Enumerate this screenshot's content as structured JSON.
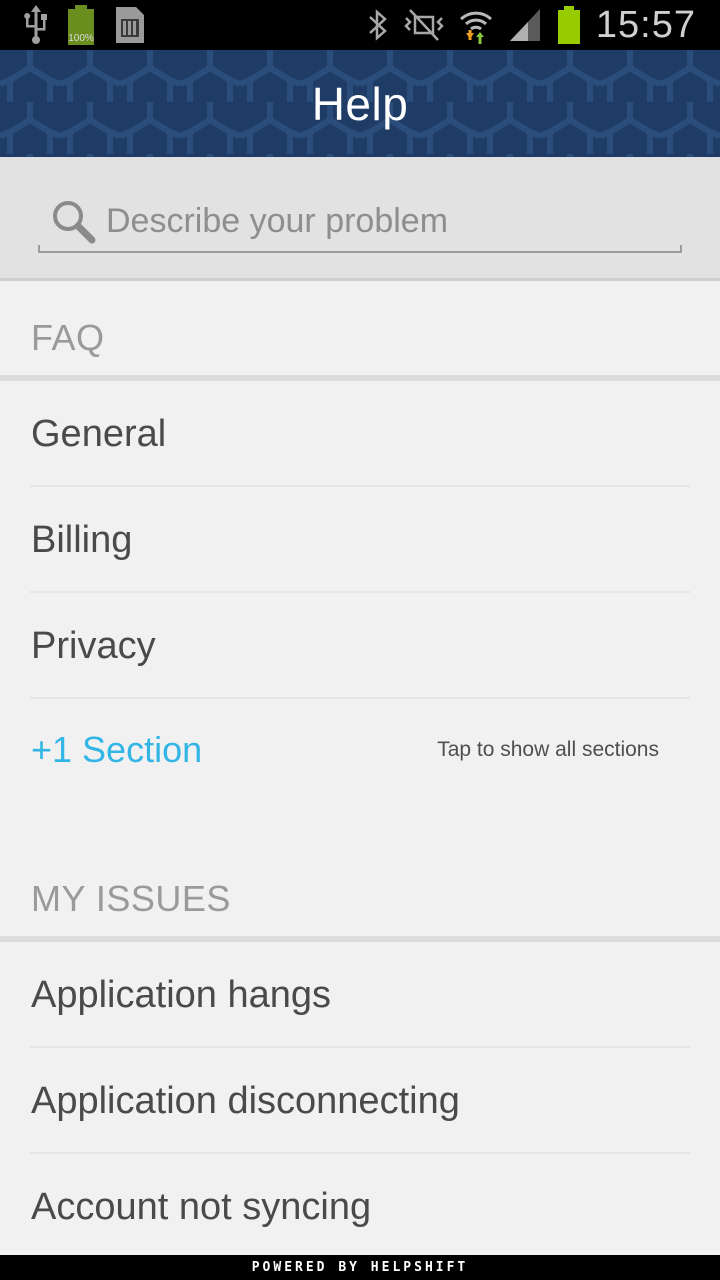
{
  "status_bar": {
    "time": "15:57",
    "battery_small_label": "100%",
    "icons": [
      "usb-icon",
      "battery-full-icon",
      "sd-card-icon",
      "bluetooth-icon",
      "vibrate-off-icon",
      "wifi-icon",
      "signal-icon",
      "battery-icon"
    ]
  },
  "action_bar": {
    "title": "Help",
    "background_color": "#1f3c66"
  },
  "search": {
    "placeholder": "Describe your problem",
    "value": ""
  },
  "faq": {
    "header": "FAQ",
    "items": [
      {
        "label": "General"
      },
      {
        "label": "Billing"
      },
      {
        "label": "Privacy"
      }
    ],
    "more": {
      "label": "+1 Section",
      "hint": "Tap to show all sections",
      "accent_color": "#33b5e5"
    }
  },
  "issues": {
    "header": "MY ISSUES",
    "items": [
      {
        "label": "Application hangs"
      },
      {
        "label": "Application disconnecting"
      },
      {
        "label": "Account not syncing"
      }
    ]
  },
  "footer": {
    "text": "POWERED BY HELPSHIFT"
  }
}
